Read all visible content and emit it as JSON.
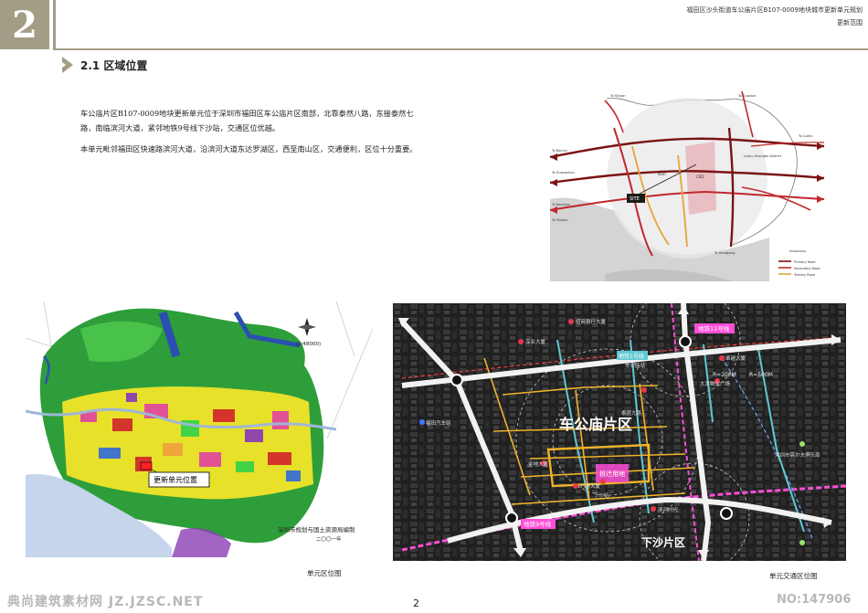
{
  "header": {
    "chapter_number": "2",
    "title": "福田区沙头街道车公庙片区B107-0009地块城市更新单元规划",
    "subtitle": "更新范围"
  },
  "section": {
    "title": "2.1 区域位置"
  },
  "body": {
    "paragraph_1": "车公庙片区B107-0009地块更新单元位于深圳市福田区车公庙片区南部，北靠泰然八路，东接泰然七路，南临滨河大道，紧邻地铁9号线下沙站，交通区位优越。",
    "paragraph_2": "本单元毗邻福田区快速路滨河大道，沿滨河大道东达罗湖区，西至南山区，交通便利，区位十分重要。"
  },
  "regional_map": {
    "labels": {
      "to_shiyan": "To Shiyan",
      "to_guanlan": "To Guanlan",
      "to_luohu": "To Luohu",
      "to_bao_an": "To Bao'an",
      "to_guangzhou": "To Guangzhou",
      "to_nanshan": "To Nanshan",
      "to_shekou": "To Shekou",
      "to_hongkong": "To Hongkong",
      "cbd": "CBD",
      "site": "SITE",
      "distance": "4km",
      "luohu_shanghai_district": "Luohu Shangbu District",
      "hongkong": "HONGKONG"
    },
    "legend": [
      {
        "label": "Primary Road",
        "color": "#7a1414"
      },
      {
        "label": "Secondary Road",
        "color": "#c0282d"
      },
      {
        "label": "Tertiary Road",
        "color": "#e8a33a"
      }
    ]
  },
  "landuse_map": {
    "callout": "更新单元位置",
    "scale": "(1/48000)",
    "credit_line_1": "深圳市规划与国土资源局编制",
    "credit_line_2": "二〇〇一年"
  },
  "aerial_map": {
    "district_main": "车公庙片区",
    "district_south": "下沙片区",
    "metro_line_11": "地铁11号线",
    "metro_line_9": "地铁9号线",
    "metro_line_1": "地铁1号线",
    "planned_land": "拆迁用地",
    "radius_200": "R=200M",
    "radius_500": "R=500M",
    "pois": [
      "招商银行大厦",
      "深业大厦",
      "车公庙站",
      "卓越大厦",
      "大发物业广场",
      "福田汽车站",
      "泰然九路",
      "滨河时代",
      "下沙站",
      "金地大厦",
      "深圳市高尔夫俱乐部",
      "万通大厦"
    ]
  },
  "captions": {
    "landuse": "单元区位图",
    "traffic": "单元交通区位图"
  },
  "footer": {
    "watermark": "典尚建筑素材网 JZ.JZSC.NET",
    "id": "NO:147906",
    "page_number": "2"
  }
}
